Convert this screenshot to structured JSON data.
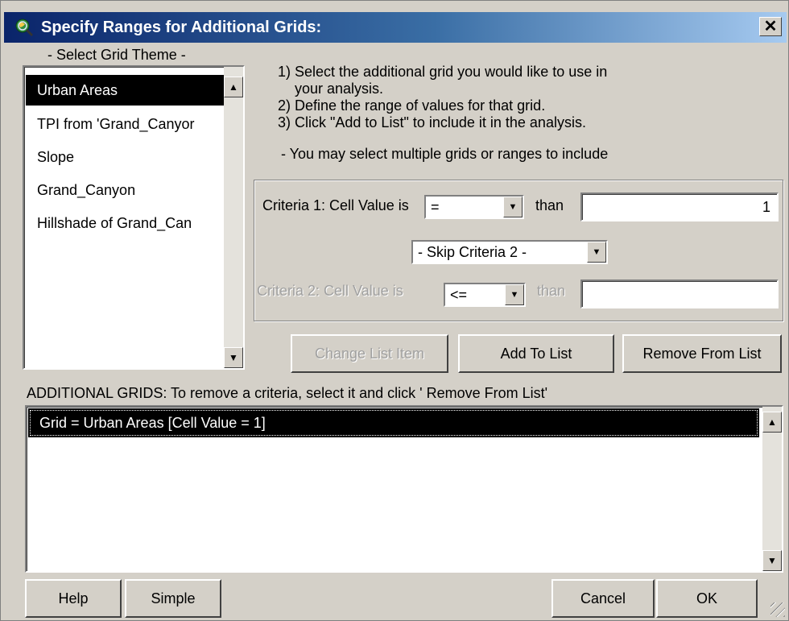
{
  "window": {
    "title": "Specify Ranges for Additional Grids:",
    "close_glyph": "✕"
  },
  "theme_list": {
    "heading": "- Select Grid Theme -",
    "items": [
      "Urban Areas",
      "TPI from 'Grand_Canyor",
      "Slope",
      "Grand_Canyon",
      "Hillshade of Grand_Can"
    ],
    "selected_index": 0
  },
  "instructions": {
    "line1": "1) Select the additional grid you would like to use in",
    "line1b": "your analysis.",
    "line2": "2) Define the range of values for that grid.",
    "line3": "3) Click \"Add to List\" to include it in the analysis.",
    "note": "- You may select multiple grids or ranges to include"
  },
  "criteria1": {
    "label": "Criteria 1:  Cell Value is",
    "operator": "=",
    "than_label": "than",
    "value": "1"
  },
  "skip_combo": {
    "value": "- Skip Criteria 2 -"
  },
  "criteria2": {
    "label": "Criteria 2:  Cell Value is",
    "operator": "<=",
    "than_label": "than",
    "value": ""
  },
  "buttons": {
    "change": "Change List Item",
    "add": "Add To List",
    "remove": "Remove From List",
    "help": "Help",
    "simple": "Simple",
    "cancel": "Cancel",
    "ok": "OK"
  },
  "additional": {
    "heading": "ADDITIONAL GRIDS:  To remove a criteria, select it and click ' Remove From List'",
    "items": [
      "Grid = Urban Areas [Cell Value  = 1]"
    ]
  },
  "icons": {
    "scroll_up": "▲",
    "scroll_down": "▼",
    "combo_arrow": "▼"
  },
  "colors": {
    "titlebar_start": "#0a246a",
    "titlebar_end": "#a6caf0",
    "dialog_face": "#d4d0c8",
    "selection": "#000000"
  }
}
